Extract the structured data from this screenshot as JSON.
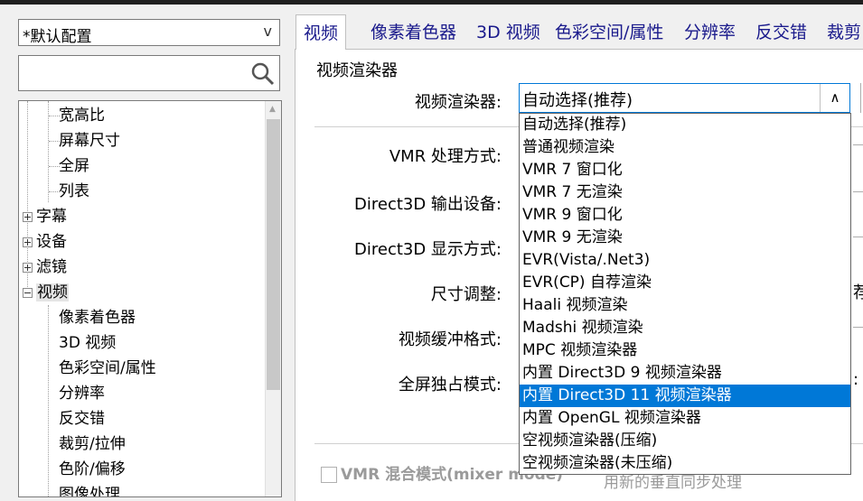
{
  "preset": {
    "value": "*默认配置",
    "arrow": "v"
  },
  "search": {
    "value": "",
    "placeholder": ""
  },
  "tree": {
    "items": [
      {
        "label": "宽高比"
      },
      {
        "label": "屏幕尺寸"
      },
      {
        "label": "全屏"
      },
      {
        "label": "列表"
      },
      {
        "label": "字幕"
      },
      {
        "label": "设备"
      },
      {
        "label": "滤镜"
      },
      {
        "label": "视频"
      },
      {
        "label": "像素着色器"
      },
      {
        "label": "3D 视频"
      },
      {
        "label": "色彩空间/属性"
      },
      {
        "label": "分辨率"
      },
      {
        "label": "反交错"
      },
      {
        "label": "裁剪/拉伸"
      },
      {
        "label": "色阶/偏移"
      },
      {
        "label": "图像处理"
      }
    ]
  },
  "tabs": [
    "视频",
    "像素着色器",
    "3D 视频",
    "色彩空间/属性",
    "分辨率",
    "反交错",
    "裁剪"
  ],
  "group_title": "视频渲染器",
  "fields": {
    "renderer": "视频渲染器:",
    "vmr_mode": "VMR 处理方式:",
    "d3d_device": "Direct3D 输出设备:",
    "d3d_display": "Direct3D 显示方式:",
    "resize": "尺寸调整:",
    "buffer_format": "视频缓冲格式:",
    "exclusive": "全屏独占模式:"
  },
  "renderer_combo": {
    "value": "自动选择(推荐)",
    "button": "∧"
  },
  "dropdown_items": [
    "自动选择(推荐)",
    "普通视频渲染",
    "VMR 7 窗口化",
    "VMR 7 无渲染",
    "VMR 9 窗口化",
    "VMR 9 无渲染",
    "EVR(Vista/.Net3)",
    "EVR(CP) 自荐渲染",
    "Haali 视频渲染",
    "Madshi 视频渲染",
    "MPC 视频渲染器",
    "内置 Direct3D 9 视频渲染器",
    "内置 Direct3D 11 视频渲染器",
    "内置 OpenGL 视频渲染器",
    "空视频渲染器(压缩)",
    "空视频渲染器(未压缩)"
  ],
  "dropdown_selected_index": 12,
  "clipped": {
    "resize_right": "荐",
    "exclusive_right": ":"
  },
  "bottom": {
    "vmr_mix": "VMR 混合模式(mixer mode)",
    "sync": "用新的垂直同步处理"
  },
  "colors": {
    "accent": "#0078d7",
    "tab_text": "#1a1a8c"
  },
  "icons": {
    "search": "search-icon"
  }
}
